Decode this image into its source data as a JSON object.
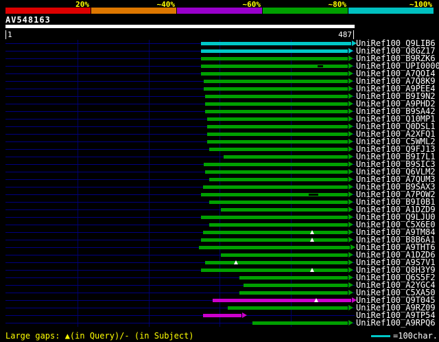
{
  "header": {
    "query_name": "AV548163",
    "axis_start": "1",
    "axis_end": "487"
  },
  "chart_data": {
    "type": "bar",
    "title": "AV548163",
    "x_range": [
      1,
      487
    ],
    "gridline_interval": 100,
    "identity_scale": {
      "labels": [
        "20%",
        "~40%",
        "~60%",
        "~80%",
        "~100%"
      ],
      "colors": [
        "#dd0000",
        "#dd7700",
        "#9900cc",
        "#00a000",
        "#00c0c0"
      ]
    },
    "bar_colors": {
      "green": "#00a000",
      "cyan": "#00c8c8",
      "magenta": "#cc00cc"
    },
    "hits": [
      {
        "label": "UniRef100_Q9LIB6",
        "color": "cyan",
        "start": 273,
        "end": 485,
        "markers": []
      },
      {
        "label": "UniRef100_Q8GZ17",
        "color": "cyan",
        "start": 273,
        "end": 480,
        "markers": []
      },
      {
        "label": "UniRef100_B9RZK6",
        "color": "green",
        "start": 273,
        "end": 480,
        "markers": []
      },
      {
        "label": "UniRef100_UPI0000...",
        "color": "green",
        "start": 273,
        "end": 480,
        "markers": [
          {
            "type": "dash",
            "at": 442,
            "w": 8
          }
        ]
      },
      {
        "label": "UniRef100_A7QOI4",
        "color": "green",
        "start": 273,
        "end": 480,
        "markers": []
      },
      {
        "label": "UniRef100_A7Q8K9",
        "color": "green",
        "start": 277,
        "end": 480,
        "markers": []
      },
      {
        "label": "UniRef100_A9PEE4",
        "color": "green",
        "start": 277,
        "end": 480,
        "markers": []
      },
      {
        "label": "UniRef100_B9I9N2",
        "color": "green",
        "start": 279,
        "end": 480,
        "markers": []
      },
      {
        "label": "UniRef100_A9PHD2",
        "color": "green",
        "start": 279,
        "end": 480,
        "markers": []
      },
      {
        "label": "UniRef100_B9SA42",
        "color": "green",
        "start": 279,
        "end": 480,
        "markers": []
      },
      {
        "label": "UniRef100_Q10MP1",
        "color": "green",
        "start": 282,
        "end": 480,
        "markers": []
      },
      {
        "label": "UniRef100_Q0DSL1",
        "color": "green",
        "start": 282,
        "end": 480,
        "markers": []
      },
      {
        "label": "UniRef100_A2XFQ1",
        "color": "green",
        "start": 282,
        "end": 480,
        "markers": []
      },
      {
        "label": "UniRef100_C5WML2",
        "color": "green",
        "start": 282,
        "end": 480,
        "markers": []
      },
      {
        "label": "UniRef100_Q9FJ13",
        "color": "green",
        "start": 285,
        "end": 480,
        "markers": []
      },
      {
        "label": "UniRef100_B9I7L1",
        "color": "green",
        "start": 305,
        "end": 480,
        "markers": []
      },
      {
        "label": "UniRef100_B9SIC3",
        "color": "green",
        "start": 277,
        "end": 480,
        "markers": []
      },
      {
        "label": "UniRef100_Q6VLM2",
        "color": "green",
        "start": 279,
        "end": 480,
        "markers": []
      },
      {
        "label": "UniRef100_A7QUM3",
        "color": "green",
        "start": 285,
        "end": 480,
        "markers": []
      },
      {
        "label": "UniRef100_B9SAX3",
        "color": "green",
        "start": 276,
        "end": 480,
        "markers": []
      },
      {
        "label": "UniRef100_A7POW2",
        "color": "green",
        "start": 273,
        "end": 480,
        "markers": [
          {
            "type": "dash",
            "at": 432,
            "w": 14
          }
        ]
      },
      {
        "label": "UniRef100_B9I0B1",
        "color": "green",
        "start": 285,
        "end": 480,
        "markers": []
      },
      {
        "label": "UniRef100_A1DZD9",
        "color": "green",
        "start": 301,
        "end": 480,
        "markers": []
      },
      {
        "label": "UniRef100_Q9LJU0",
        "color": "green",
        "start": 273,
        "end": 480,
        "markers": []
      },
      {
        "label": "UniRef100_C5X6E0",
        "color": "green",
        "start": 285,
        "end": 480,
        "markers": []
      },
      {
        "label": "UniRef100_A9TM84",
        "color": "green",
        "start": 276,
        "end": 480,
        "markers": [
          {
            "type": "tri",
            "at": 430
          }
        ]
      },
      {
        "label": "UniRef100_B8B6A1",
        "color": "green",
        "start": 273,
        "end": 480,
        "markers": [
          {
            "type": "tri",
            "at": 430
          }
        ]
      },
      {
        "label": "UniRef100_A9THT6",
        "color": "green",
        "start": 271,
        "end": 483,
        "markers": []
      },
      {
        "label": "UniRef100_A1DZD6",
        "color": "green",
        "start": 301,
        "end": 480,
        "markers": []
      },
      {
        "label": "UniRef100_A9S7V1",
        "color": "green",
        "start": 279,
        "end": 480,
        "markers": [
          {
            "type": "tri",
            "at": 323
          }
        ]
      },
      {
        "label": "UniRef100_Q8H3Y9",
        "color": "green",
        "start": 273,
        "end": 480,
        "markers": [
          {
            "type": "tri",
            "at": 430
          }
        ]
      },
      {
        "label": "UniRef100_Q6S5F2",
        "color": "green",
        "start": 328,
        "end": 480,
        "markers": []
      },
      {
        "label": "UniRef100_A2YGC4",
        "color": "green",
        "start": 333,
        "end": 480,
        "markers": []
      },
      {
        "label": "UniRef100_C5XA50",
        "color": "green",
        "start": 328,
        "end": 480,
        "markers": []
      },
      {
        "label": "UniRef100_Q9T045",
        "color": "magenta",
        "start": 290,
        "end": 485,
        "markers": [
          {
            "type": "tri",
            "at": 436
          }
        ]
      },
      {
        "label": "UniRef100_A9RZ09",
        "color": "green",
        "start": 311,
        "end": 480,
        "markers": []
      },
      {
        "label": "UniRef100_A9TP54",
        "color": "magenta",
        "start": 276,
        "end": 330,
        "markers": []
      },
      {
        "label": "UniRef100_A9RPQ6",
        "color": "green",
        "start": 346,
        "end": 480,
        "markers": []
      }
    ]
  },
  "footer": {
    "gaps_note": "Large gaps: ▲(in Query)/- (in Subject)",
    "scale_note": "=100char."
  }
}
